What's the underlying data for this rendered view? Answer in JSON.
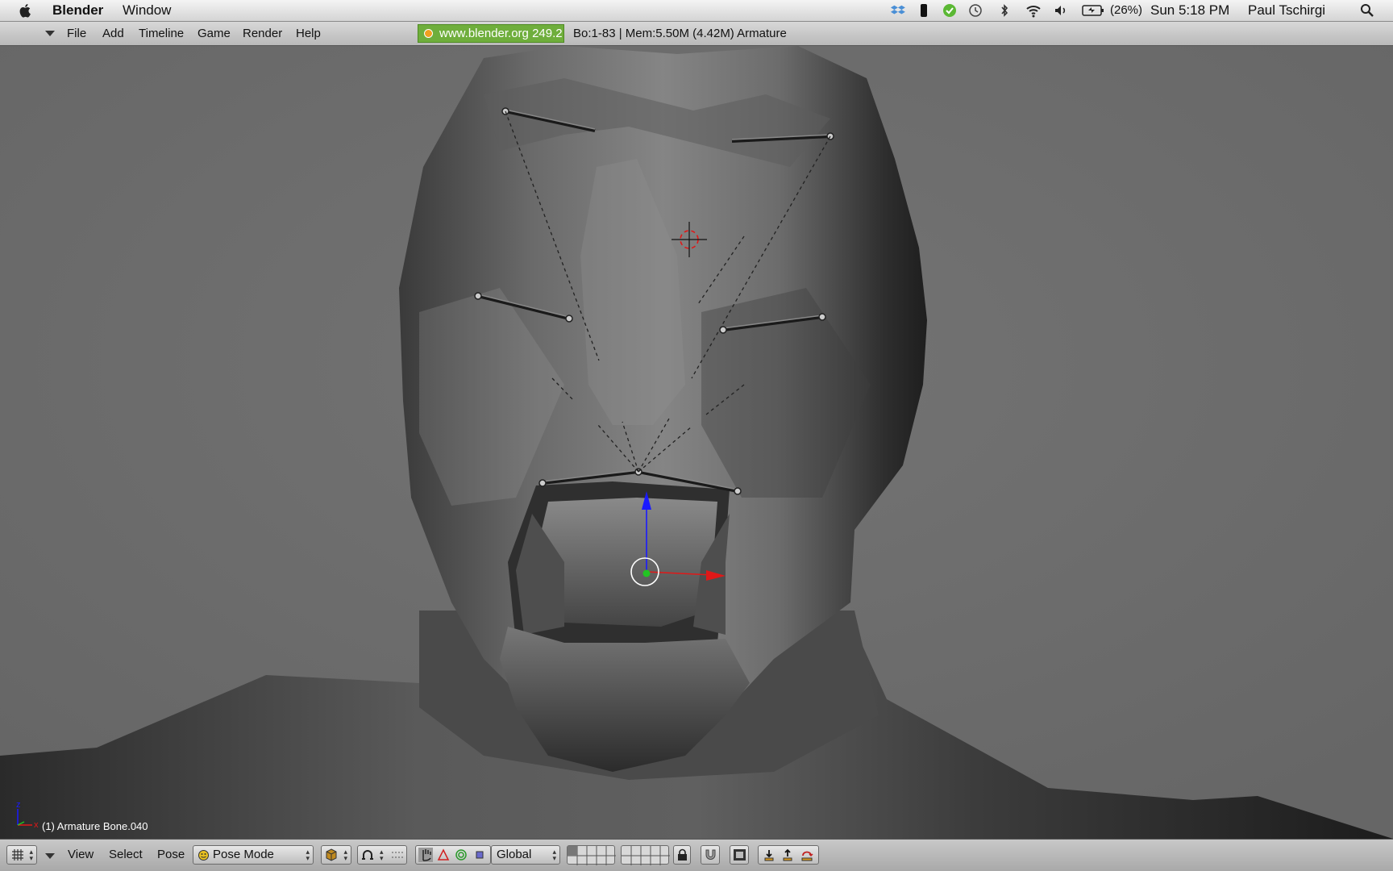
{
  "mac_menubar": {
    "app_name": "Blender",
    "menus": [
      "Window"
    ],
    "battery": "(26%)",
    "clock": "Sun 5:18 PM",
    "user": "Paul Tschirgi"
  },
  "blender_header": {
    "menus": [
      "File",
      "Add",
      "Timeline",
      "Game",
      "Render",
      "Help"
    ],
    "version_badge": "www.blender.org 249.2",
    "stats": "Bo:1-83   | Mem:5.50M (4.42M) Armature"
  },
  "viewport": {
    "selection_info": "(1) Armature Bone.040",
    "axis_labels": {
      "z": "z",
      "x": "x"
    }
  },
  "footer": {
    "menus": [
      "View",
      "Select",
      "Pose"
    ],
    "mode_select": "Pose Mode",
    "orientation_select": "Global"
  },
  "colors": {
    "version_badge": "#6fae3c",
    "manipulator_z": "#1a1aff",
    "manipulator_x": "#e01818",
    "pivot_dot": "#22c422"
  }
}
